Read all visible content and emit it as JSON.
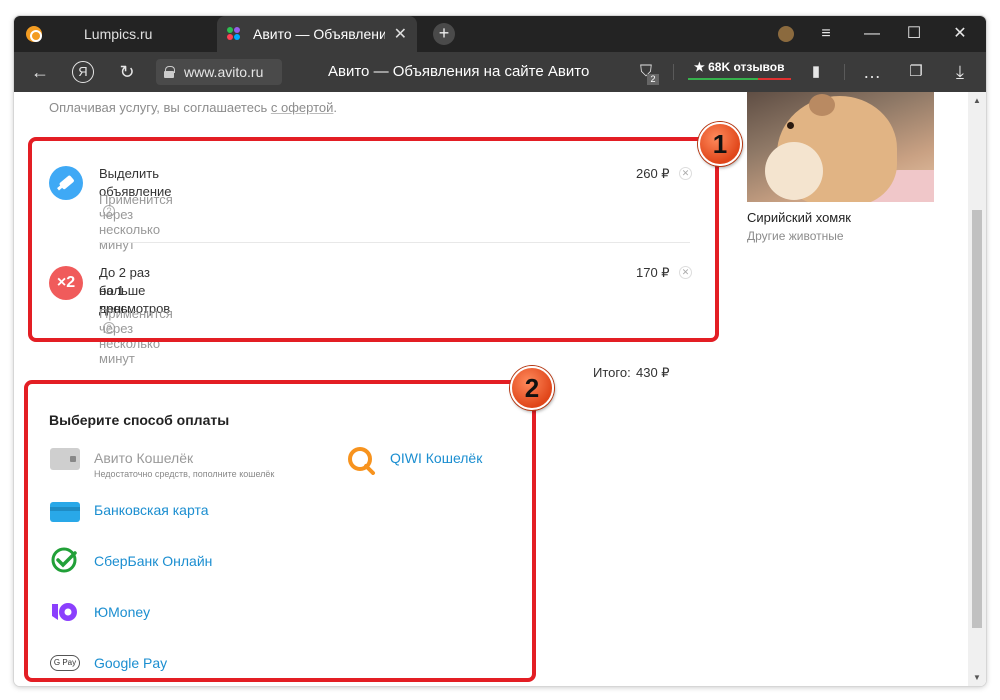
{
  "browser": {
    "tabs": [
      {
        "label": "Lumpics.ru"
      },
      {
        "label": "Авито — Объявления на сайте Авито"
      }
    ],
    "url": "www.avito.ru",
    "page_title": "Авито — Объявления на сайте Авито",
    "reviews_label": "★ 68K отзывов",
    "protect_badge": "2"
  },
  "agreement": {
    "text": "Оплачивая услугу, вы соглашаетесь",
    "link": "с офертой",
    "end": "."
  },
  "services": [
    {
      "title": "Выделить объявление",
      "subtitle": "Применится через несколько минут",
      "price": "260 ₽",
      "icon": "highlight-icon",
      "icon_color": "#3fa9f5"
    },
    {
      "title": "До 2 раз больше просмотров",
      "title2": "на 1 день",
      "subtitle": "Применится через несколько минут",
      "price": "170 ₽",
      "icon": "x2-icon",
      "icon_color": "#f05b5b"
    }
  ],
  "total": {
    "label": "Итого:",
    "value": "430 ₽"
  },
  "payment": {
    "heading": "Выберите способ оплаты",
    "methods": [
      {
        "label": "Авито Кошелёк",
        "note": "Недостаточно средств, пополните кошелёк",
        "icon": "wallet-icon",
        "enabled": false
      },
      {
        "label": "QIWI Кошелёк",
        "icon": "qiwi-icon",
        "enabled": true
      },
      {
        "label": "Банковская карта",
        "icon": "bank-card-icon",
        "enabled": true
      },
      {
        "label": "СберБанк Онлайн",
        "icon": "sberbank-icon",
        "enabled": true
      },
      {
        "label": "ЮMoney",
        "icon": "yoomoney-icon",
        "enabled": true
      },
      {
        "label": "Google Pay",
        "icon": "google-pay-icon",
        "enabled": true
      }
    ]
  },
  "ad_card": {
    "name": "Сирийский хомяк",
    "category": "Другие животные"
  },
  "annotations": [
    "1",
    "2"
  ],
  "colors": {
    "highlight": "#e31e24",
    "link": "#1b8ed0"
  }
}
